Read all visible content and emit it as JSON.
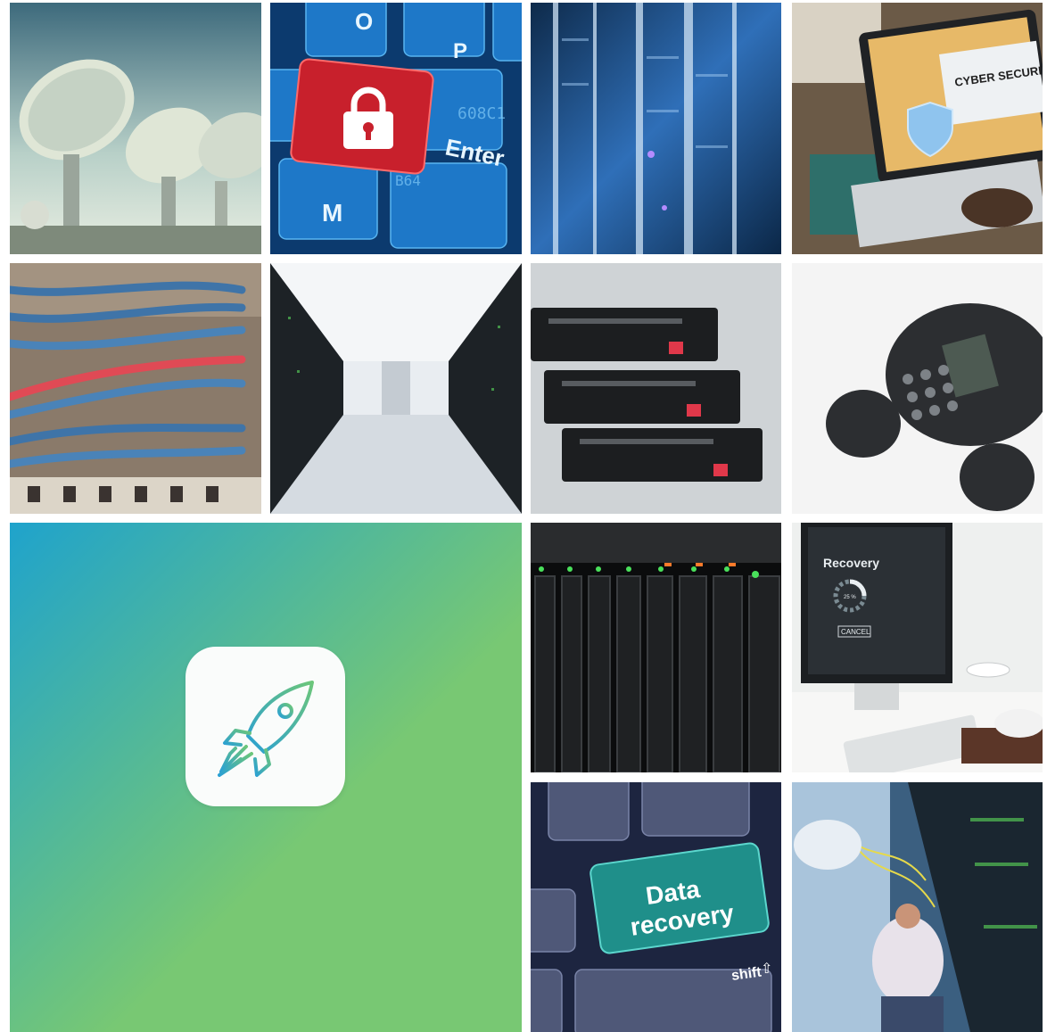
{
  "gallery": {
    "tiles": [
      {
        "subject": "satellite-dishes"
      },
      {
        "subject": "keyboard-lock",
        "key_letters": [
          "O",
          "P",
          "Enter",
          "M"
        ],
        "hex_text": [
          "608C1",
          "B64"
        ]
      },
      {
        "subject": "server-rack"
      },
      {
        "subject": "cyber-security-laptop",
        "screen_label": "CYBER SECURITY"
      },
      {
        "subject": "network-cables"
      },
      {
        "subject": "server-corridor"
      },
      {
        "subject": "hard-drives"
      },
      {
        "subject": "conference-phone"
      },
      {
        "subject": "feature-tile",
        "icon": "rocket-icon"
      },
      {
        "subject": "drive-bays"
      },
      {
        "subject": "recovery-monitor",
        "screen_title": "Recovery",
        "progress_label": "25 %",
        "cancel_label": "CANCEL"
      },
      {
        "subject": "data-recovery-key",
        "key_line1": "Data",
        "key_line2": "recovery",
        "shift_label": "shift"
      },
      {
        "subject": "technician-servers"
      }
    ]
  },
  "colors": {
    "gradient_start": "#1fa3cc",
    "gradient_end": "#78c873",
    "lock_key": "#d42a35",
    "recovery_key": "#1f8f8a"
  }
}
